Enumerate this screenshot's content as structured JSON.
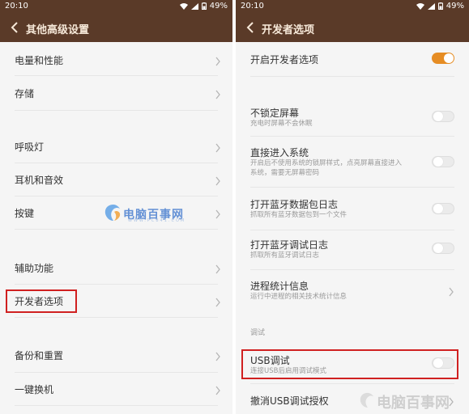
{
  "left": {
    "status": {
      "time": "20:10",
      "battery": "49%"
    },
    "title": "其他高级设置",
    "items": [
      {
        "label": "电量和性能"
      },
      {
        "label": "存储"
      },
      {
        "label": "呼吸灯"
      },
      {
        "label": "耳机和音效"
      },
      {
        "label": "按键"
      },
      {
        "label": "辅助功能"
      },
      {
        "label": "开发者选项"
      },
      {
        "label": "备份和重置"
      },
      {
        "label": "一键换机"
      }
    ]
  },
  "right": {
    "status": {
      "time": "20:10",
      "battery": "49%"
    },
    "title": "开发者选项",
    "master_toggle": {
      "label": "开启开发者选项",
      "on": true
    },
    "items": [
      {
        "label": "不锁定屏幕",
        "sub": "充电时屏幕不会休眠",
        "control": "toggle",
        "on": false
      },
      {
        "label": "直接进入系统",
        "sub": "开启后不使用系统的锁屏样式，点亮屏幕直接进入系统，需要无屏幕密码",
        "sub1": "开启后不使用系统的锁屏样式，点亮屏幕直接进入",
        "sub2": "系统，需要无屏幕密码",
        "control": "toggle",
        "on": false
      },
      {
        "label": "打开蓝牙数据包日志",
        "sub": "抓取所有蓝牙数据包到一个文件",
        "control": "toggle",
        "on": false
      },
      {
        "label": "打开蓝牙调试日志",
        "sub": "抓取所有蓝牙调试日志",
        "control": "toggle",
        "on": false
      },
      {
        "label": "进程统计信息",
        "sub": "运行中进程的相关技术统计信息",
        "control": "chevron"
      }
    ],
    "section": "调试",
    "usb_debug": {
      "label": "USB调试",
      "sub": "连接USB后启用调试模式",
      "on": false
    },
    "revoke": {
      "label": "撤消USB调试授权"
    }
  },
  "watermarks": {
    "wm1": "电脑百事网",
    "wm1_url": "WWW.PC841.COM",
    "wm2": "电脑百事网"
  },
  "colors": {
    "titlebar": "#5a3a28",
    "accent": "#e68d24",
    "highlight": "#d02020"
  }
}
